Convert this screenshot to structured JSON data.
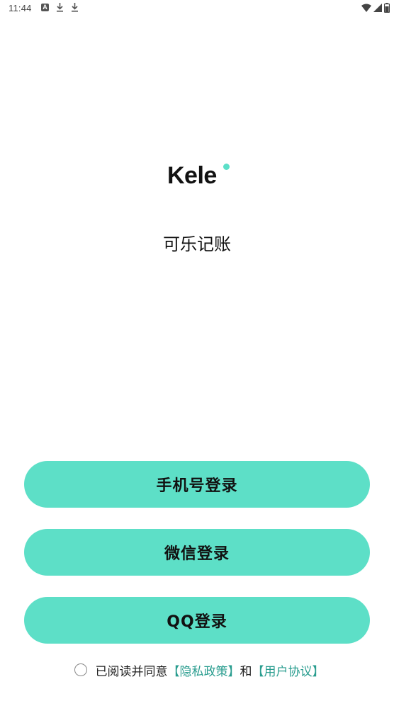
{
  "status_bar": {
    "time": "11:44",
    "notification_a": "A"
  },
  "app": {
    "logo": "Kele",
    "title": "可乐记账"
  },
  "buttons": {
    "phone_login": "手机号登录",
    "wechat_login": "微信登录",
    "qq_login": "QQ登录"
  },
  "agreement": {
    "prefix": "已阅读并同意",
    "privacy_link": "【隐私政策】",
    "conjunction": "和",
    "terms_link": "【用户协议】",
    "checked": false
  },
  "colors": {
    "accent": "#5ddfc7",
    "link": "#2a9d8f"
  }
}
